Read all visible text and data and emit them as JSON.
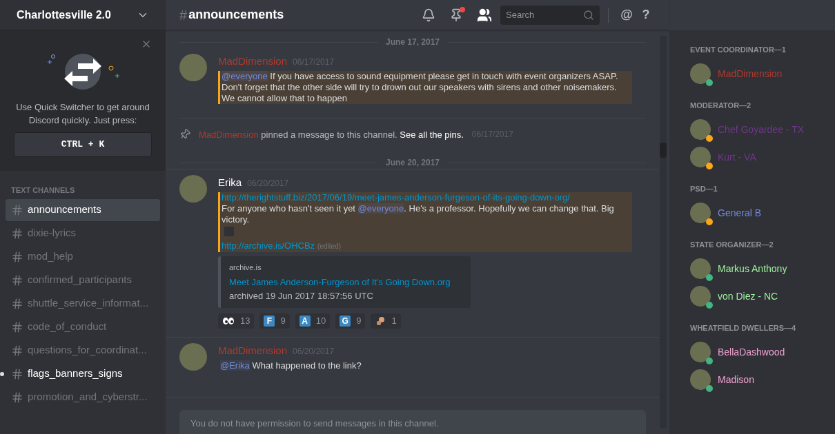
{
  "server": {
    "name": "Charlottesville 2.0"
  },
  "quick_switcher": {
    "text": "Use Quick Switcher to get around Discord quickly. Just press:",
    "shortcut": "CTRL + K"
  },
  "channel_category": "TEXT CHANNELS",
  "channels": [
    {
      "name": "announcements",
      "selected": true,
      "unread": false
    },
    {
      "name": "dixie-lyrics",
      "selected": false,
      "unread": false
    },
    {
      "name": "mod_help",
      "selected": false,
      "unread": false
    },
    {
      "name": "confirmed_participants",
      "selected": false,
      "unread": false
    },
    {
      "name": "shuttle_service_informat...",
      "selected": false,
      "unread": false
    },
    {
      "name": "code_of_conduct",
      "selected": false,
      "unread": false
    },
    {
      "name": "questions_for_coordinat...",
      "selected": false,
      "unread": false
    },
    {
      "name": "flags_banners_signs",
      "selected": false,
      "unread": true
    },
    {
      "name": "promotion_and_cyberstr...",
      "selected": false,
      "unread": false
    }
  ],
  "header": {
    "hash": "#",
    "channel": "announcements",
    "pins_unread": true,
    "search_placeholder": "Search",
    "buttons": [
      "@",
      "?"
    ]
  },
  "feed": [
    {
      "kind": "date",
      "text": "June 17, 2017"
    },
    {
      "kind": "message",
      "author": "MadDimension",
      "color": "#b03a2e",
      "time": "06/17/2017",
      "highlighted": true,
      "lines": [
        [
          {
            "kind": "mention",
            "text": "@everyone"
          },
          {
            "kind": "text",
            "text": " If you have access to sound equipment please get in touch with event organizers ASAP. Don't forget that the other side will try to drown out our speakers with sirens and other noisemakers. We cannot allow that to happen"
          }
        ]
      ]
    },
    {
      "kind": "pin",
      "author": "MadDimension",
      "color": "#b03a2e",
      "text": "pinned a message to this channel.",
      "link": "See all the pins.",
      "time": "06/17/2017"
    },
    {
      "kind": "date",
      "text": "June 20, 2017"
    },
    {
      "kind": "message",
      "author": "Erika",
      "color": "#ffffff",
      "time": "06/20/2017",
      "highlighted": true,
      "lines": [
        [
          {
            "kind": "link",
            "text": "http://therightstuff.biz/2017/06/19/meet-james-anderson-furgeson-of-its-going-down-org/"
          }
        ],
        [
          {
            "kind": "text",
            "text": "For anyone who hasn't seen it yet "
          },
          {
            "kind": "mention",
            "text": "@everyone"
          },
          {
            "kind": "text",
            "text": ". He's a professor. Hopefully we can change that. Big victory."
          }
        ],
        [
          {
            "kind": "block"
          }
        ],
        [
          {
            "kind": "link",
            "text": "http://archive.is/OHCBz"
          },
          {
            "kind": "edited",
            "text": "(edited)"
          }
        ]
      ],
      "embed": {
        "provider": "archive.is",
        "title": "Meet James Anderson-Furgeson of It's Going Down.org",
        "description": "archived 19 Jun 2017 18:57:56 UTC"
      },
      "reactions": [
        {
          "kind": "eyes",
          "count": "13"
        },
        {
          "kind": "letter",
          "letter": "F",
          "count": "9"
        },
        {
          "kind": "letter",
          "letter": "A",
          "count": "10"
        },
        {
          "kind": "letter",
          "letter": "G",
          "count": "9"
        },
        {
          "kind": "hand",
          "count": "1"
        }
      ]
    },
    {
      "kind": "message",
      "author": "MadDimension",
      "color": "#b03a2e",
      "time": "06/20/2017",
      "highlighted": false,
      "lines": [
        [
          {
            "kind": "mention",
            "text": "@Erika"
          },
          {
            "kind": "text",
            "text": "  What happened to the link?"
          }
        ]
      ]
    }
  ],
  "composer": {
    "placeholder": "You do not have permission to send messages in this channel."
  },
  "member_groups": [
    {
      "title": "EVENT COORDINATOR—1",
      "color": "#b03a2e",
      "members": [
        {
          "name": "MadDimension",
          "color": "#43b581"
        }
      ]
    },
    {
      "title": "MODERATOR—2",
      "color": "#71368a",
      "members": [
        {
          "name": "Chef Goyardee - TX",
          "color": "#faa61a"
        },
        {
          "name": "Kurt - VA",
          "color": "#faa61a"
        }
      ]
    },
    {
      "title": "PSD—1",
      "color": "#7289da",
      "members": [
        {
          "name": "General B",
          "color": "#faa61a"
        }
      ]
    },
    {
      "title": "STATE ORGANIZER—2",
      "color": "#9ff29f",
      "members": [
        {
          "name": "Markus Anthony",
          "color": "#43b581"
        },
        {
          "name": "von Diez - NC",
          "color": "#43b581"
        }
      ]
    },
    {
      "title": "WHEATFIELD DWELLERS—4",
      "color": "#f0a0d0",
      "members": [
        {
          "name": "BellaDashwood",
          "color": "#43b581"
        },
        {
          "name": "Madison",
          "color": "#43b581"
        }
      ]
    }
  ]
}
